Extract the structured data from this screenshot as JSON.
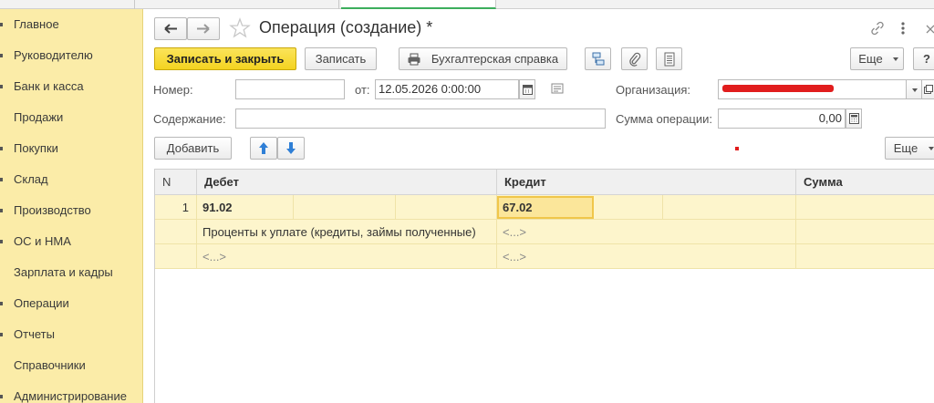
{
  "sidebar": {
    "items": [
      {
        "label": "Главное"
      },
      {
        "label": "Руководителю"
      },
      {
        "label": "Банк и касса"
      },
      {
        "label": "Продажи"
      },
      {
        "label": "Покупки"
      },
      {
        "label": "Склад"
      },
      {
        "label": "Производство"
      },
      {
        "label": "ОС и НМА"
      },
      {
        "label": "Зарплата и кадры"
      },
      {
        "label": "Операции"
      },
      {
        "label": "Отчеты"
      },
      {
        "label": "Справочники"
      },
      {
        "label": "Администрирование"
      }
    ]
  },
  "header": {
    "title": "Операция (создание) *",
    "back_icon": "arrow-left-icon",
    "forward_icon": "arrow-right-icon",
    "favorite_icon": "star-icon",
    "link_icon": "link-icon",
    "more_icon": "vertical-dots-icon",
    "close_icon": "close-icon"
  },
  "toolbar": {
    "save_close_label": "Записать и закрыть",
    "save_label": "Записать",
    "report_label": "Бухгалтерская справка",
    "more_label": "Еще",
    "help_label": "?"
  },
  "form": {
    "number_label": "Номер:",
    "number_value": "",
    "date_label": "от:",
    "date_value": "12.05.2026  0:00:00",
    "organization_label": "Организация:",
    "content_label": "Содержание:",
    "content_value": "",
    "amount_label": "Сумма операции:",
    "amount_value": "0,00",
    "accent_red": "#e11d1d"
  },
  "grid_toolbar": {
    "add_label": "Добавить",
    "more_label": "Еще"
  },
  "table": {
    "columns": [
      "N",
      "Дебет",
      "Кредит",
      "Сумма"
    ],
    "rows": [
      {
        "n": "1",
        "debit": "91.02",
        "credit": "67.02",
        "debit_sub1": "Проценты к уплате (кредиты, займы полученные)",
        "credit_sub1": "<...>",
        "debit_sub2": "<...>",
        "credit_sub2": "<...>"
      }
    ]
  },
  "colors": {
    "sidebar_bg": "#fbeca8",
    "primary_button": "#f4d320",
    "row_highlight": "#fdf5cc",
    "active_cell": "#fbe69a"
  }
}
